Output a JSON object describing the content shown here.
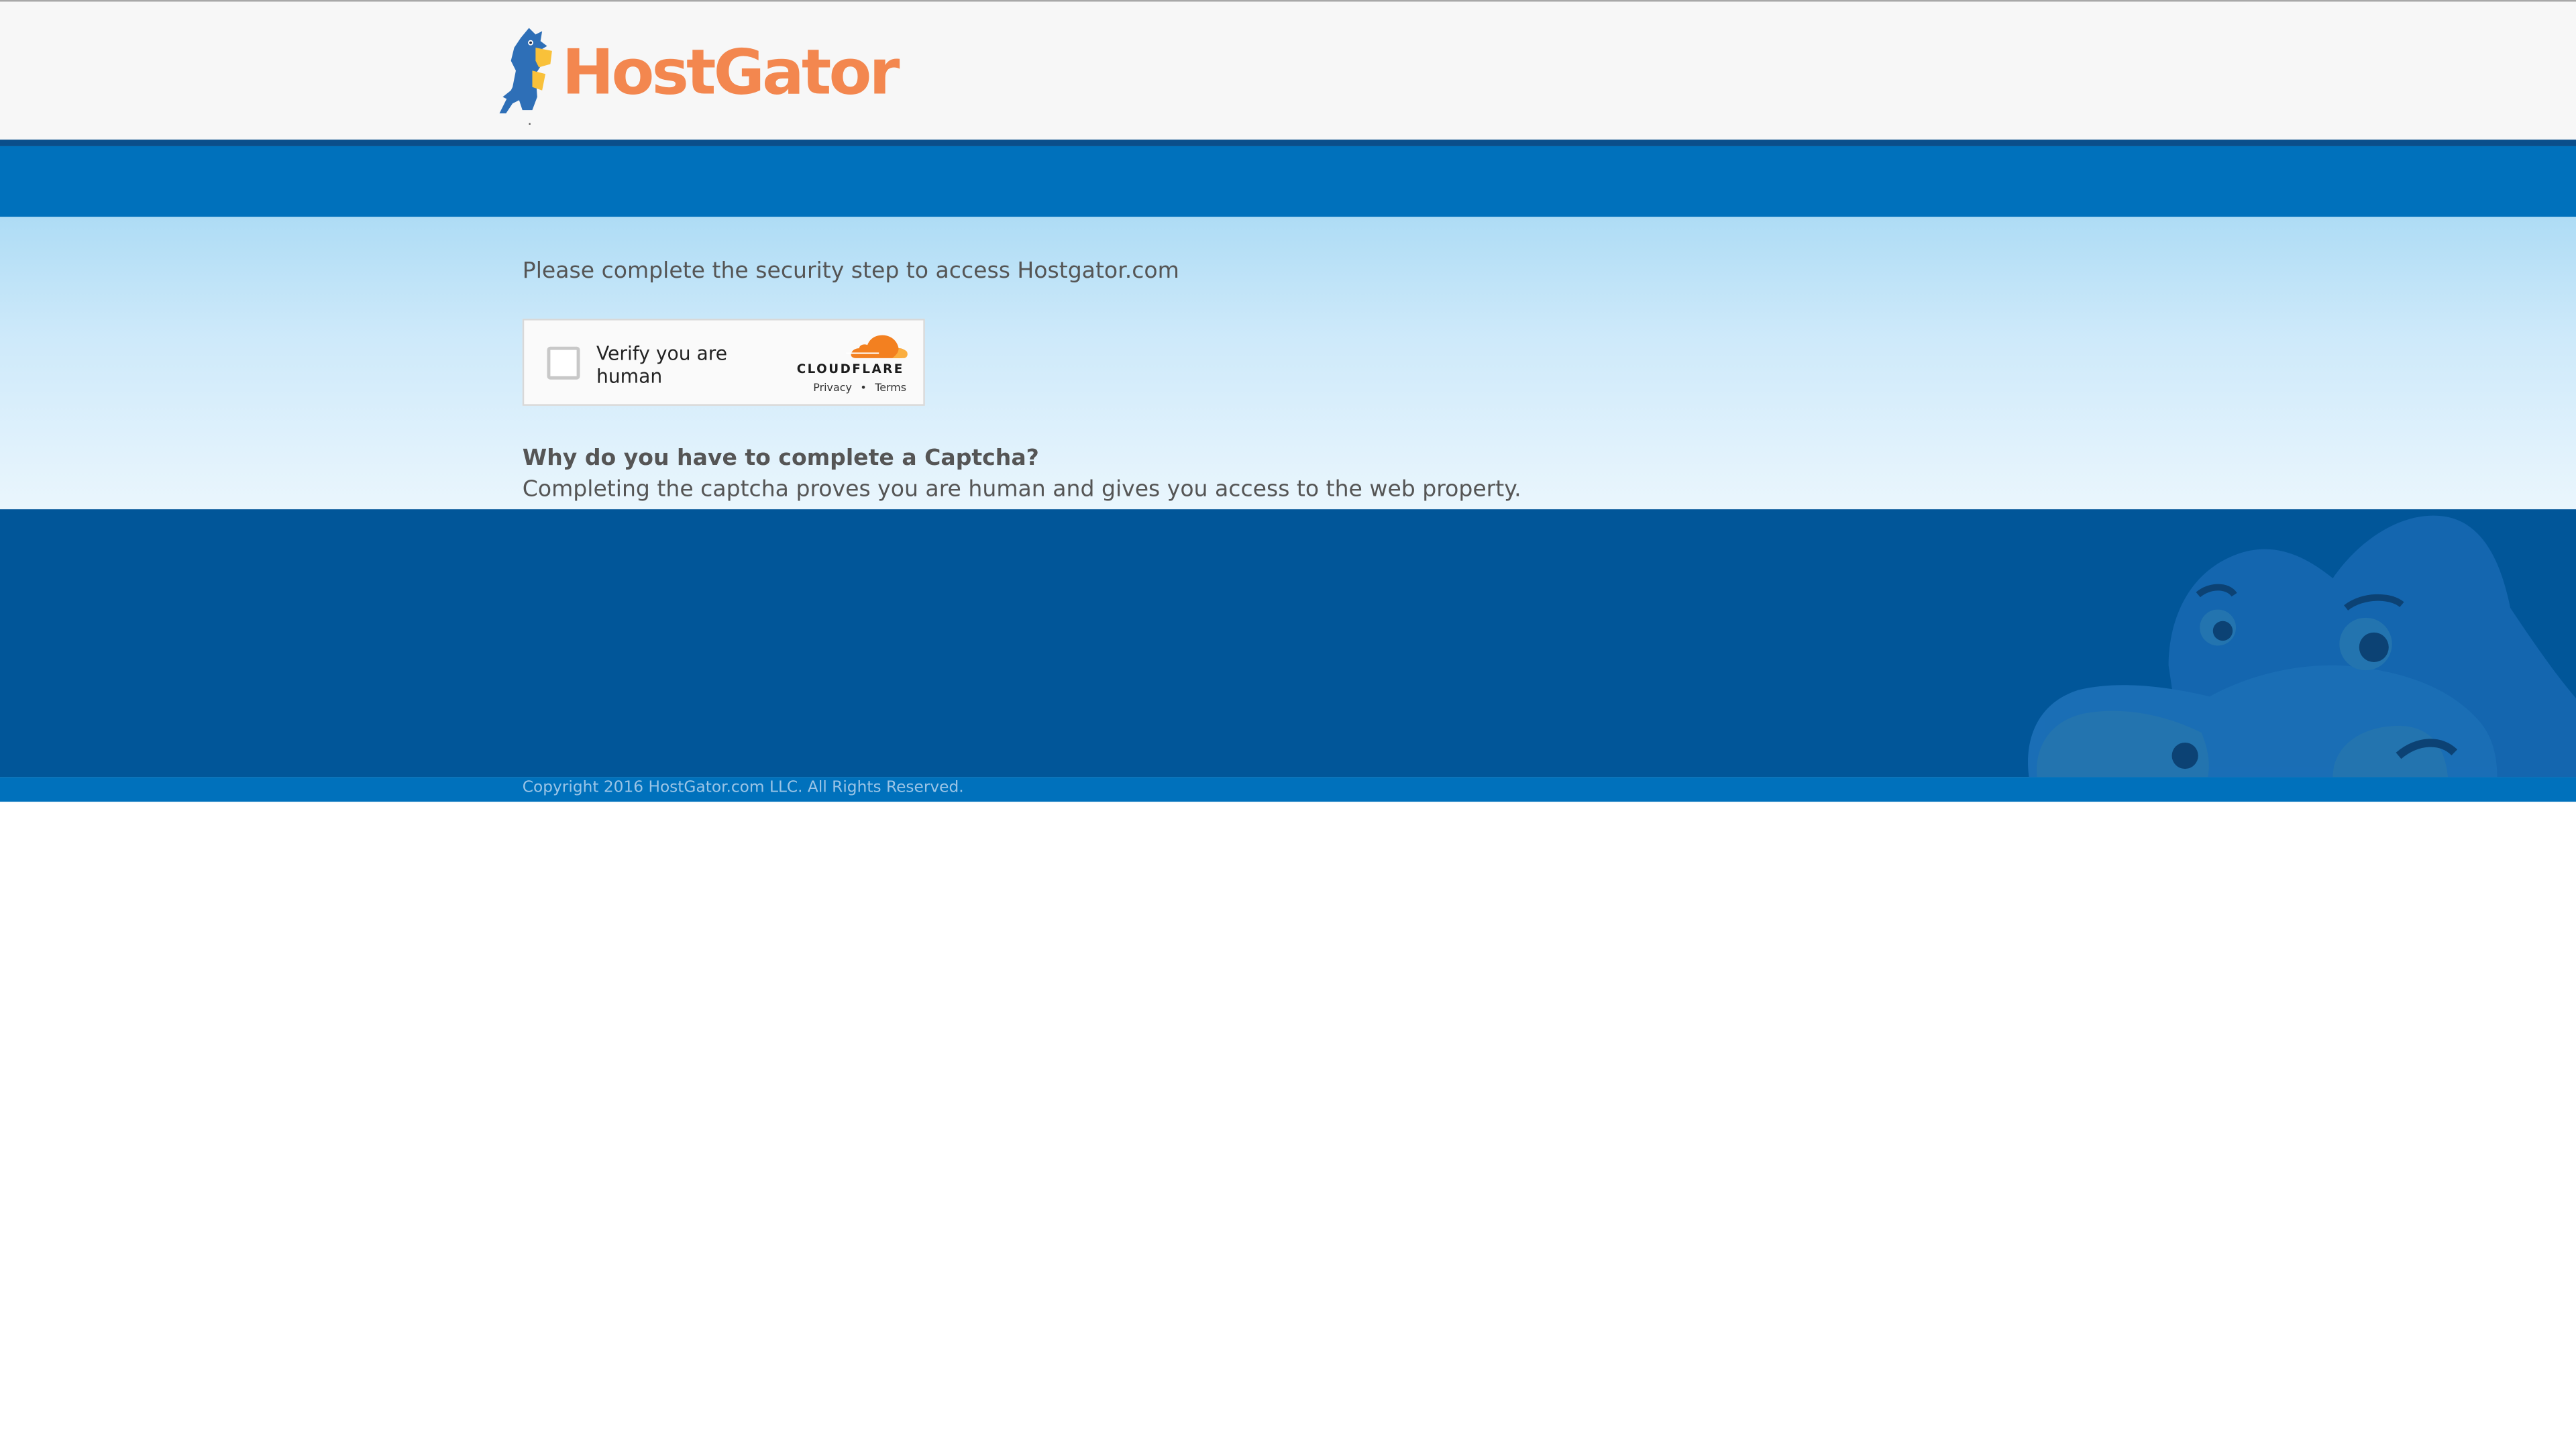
{
  "header": {
    "logo_text": "HostGator",
    "logo_dot": "."
  },
  "main": {
    "prompt": "Please complete the security step to access Hostgator.com",
    "widget": {
      "checkbox_label": "Verify you are human",
      "brand": "CLOUDFLARE",
      "privacy_link": "Privacy",
      "separator": "•",
      "terms_link": "Terms"
    },
    "why_title": "Why do you have to complete a Captcha?",
    "why_text": "Completing the captcha proves you are human and gives you access to the web property."
  },
  "footer": {
    "copyright": "Copyright 2016 HostGator.com LLC. All Rights Reserved."
  },
  "colors": {
    "brand_orange": "#f3874f",
    "blue_primary": "#0071bc",
    "blue_dark": "#015699",
    "cloudflare_orange": "#f38020"
  },
  "icons": {
    "logo_mascot": "gator-mascot-icon",
    "checkbox": "checkbox",
    "cloudflare_logo": "cloudflare-cloud-icon",
    "footer_graphic": "gator-face-icon"
  }
}
